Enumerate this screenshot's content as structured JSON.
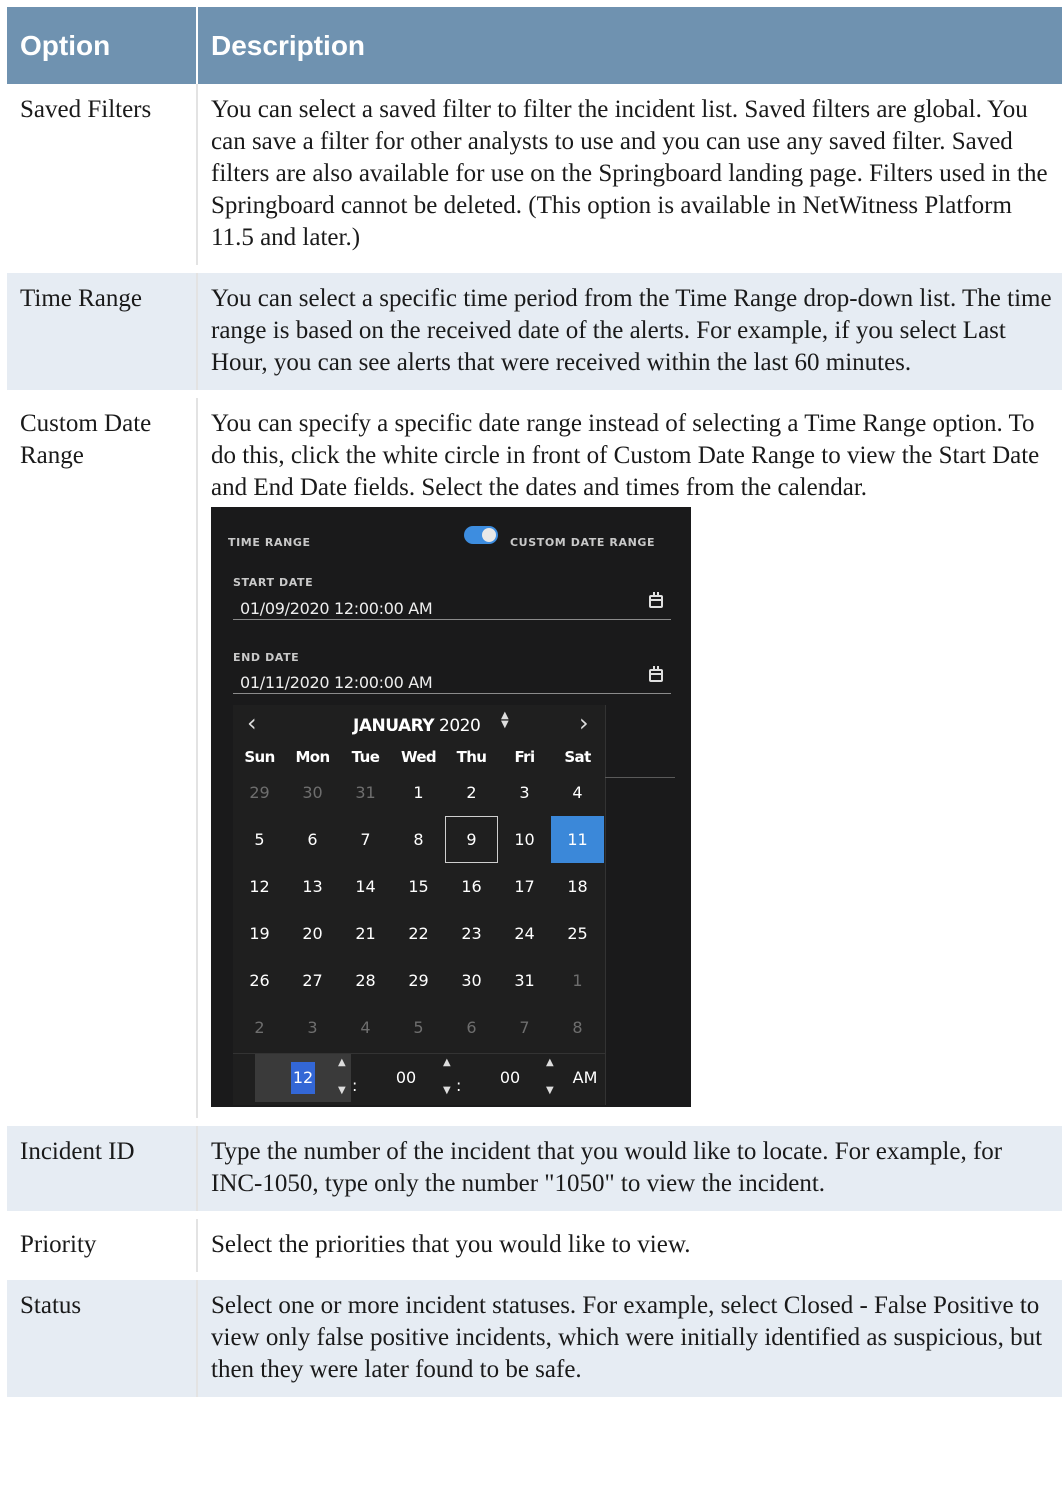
{
  "table": {
    "headers": [
      "Option",
      "Description"
    ],
    "rows": [
      {
        "option": "Saved Filters",
        "description": "You can select a saved filter to filter the incident list. Saved filters are global. You can save a filter for other analysts to use and you can use any saved filter. Saved filters are also available for use on the Springboard landing page. Filters used in the Springboard cannot be deleted. (This option is available in NetWitness Platform 11.5 and later.)"
      },
      {
        "option": "Time Range",
        "description": "You can select a specific time period from the Time Range drop-down list. The time range is based on the received date of the alerts. For example, if you select Last Hour, you can see alerts that were received within the last 60 minutes."
      },
      {
        "option": "Custom Date Range",
        "description": "You can specify a specific date range instead of selecting a Time Range option. To do this, click the white circle in front of Custom Date Range to view the Start Date and End Date fields. Select the dates and times from the calendar."
      },
      {
        "option": "Incident ID",
        "description": "Type the number of the incident that you would like to locate. For example, for INC-1050, type only the number \"1050\" to view the incident."
      },
      {
        "option": "Priority",
        "description": "Select the priorities that you would like to view."
      },
      {
        "option": "Status",
        "description": "Select one or more incident statuses. For example, select Closed - False Positive to view only false positive incidents, which were initially identified as suspicious, but then they were later found to be safe."
      }
    ]
  },
  "screenshot": {
    "time_range_label": "TIME RANGE",
    "custom_label": "CUSTOM DATE RANGE",
    "toggle_on": true,
    "start_label": "START DATE",
    "start_value": "01/09/2020 12:00:00 AM",
    "end_label": "END DATE",
    "end_value": "01/11/2020 12:00:00 AM",
    "calendar": {
      "month": "JANUARY",
      "year": "2020",
      "prev": "‹",
      "next": "›",
      "weekdays": [
        "Sun",
        "Mon",
        "Tue",
        "Wed",
        "Thu",
        "Fri",
        "Sat"
      ],
      "weeks": [
        [
          "29",
          "30",
          "31",
          "1",
          "2",
          "3",
          "4"
        ],
        [
          "5",
          "6",
          "7",
          "8",
          "9",
          "10",
          "11"
        ],
        [
          "12",
          "13",
          "14",
          "15",
          "16",
          "17",
          "18"
        ],
        [
          "19",
          "20",
          "21",
          "22",
          "23",
          "24",
          "25"
        ],
        [
          "26",
          "27",
          "28",
          "29",
          "30",
          "31",
          "1"
        ],
        [
          "2",
          "3",
          "4",
          "5",
          "6",
          "7",
          "8"
        ]
      ],
      "today": "9",
      "selected": "11"
    },
    "time": {
      "hour": "12",
      "minute": "00",
      "second": "00",
      "ampm": "AM"
    },
    "colors": {
      "accent": "#3b88d9",
      "background": "#1a1a1b"
    },
    "icons": [
      "calendar-icon",
      "chevron-left-icon",
      "chevron-right-icon",
      "spinner-icon"
    ]
  }
}
